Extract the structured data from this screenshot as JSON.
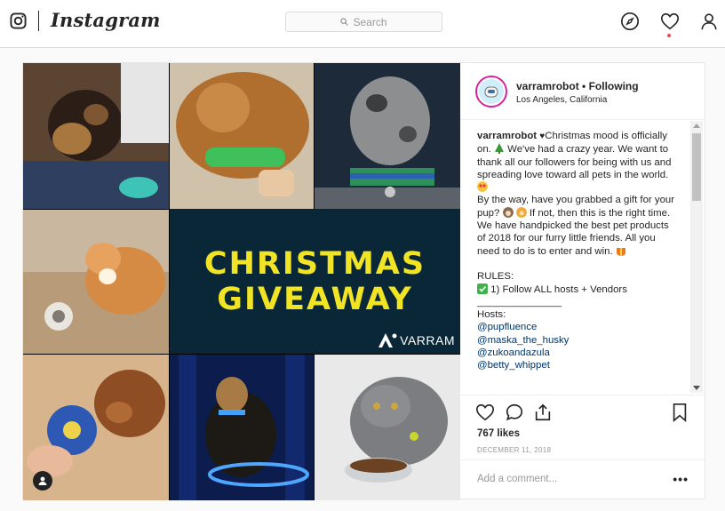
{
  "app": {
    "wordmark": "Instagram"
  },
  "search": {
    "placeholder": "Search"
  },
  "nav": {
    "icons": [
      "explore-icon",
      "activity-heart-icon",
      "profile-icon"
    ],
    "notification_color": "#ed4956"
  },
  "post": {
    "username": "varramrobot",
    "follow_status": "Following",
    "location": "Los Angeles, California",
    "media": {
      "headline_line1": "CHRISTMAS",
      "headline_line2": "GIVEAWAY",
      "brand": "VARRAM",
      "headline_color": "#f1e424",
      "panel_color": "#0a2737"
    },
    "caption": {
      "p1": "Christmas mood is officially on.",
      "p1b": " We've had a crazy year. We want to thank all our followers for being with us and spreading love toward all pets in the world.",
      "p2": "By the way, have you grabbed a gift for your pup?",
      "p2b": " If not, then this is the right time. We have handpicked the best pet products of 2018 for our furry little friends. All you need to do is to enter and win.",
      "rules_label": "RULES:",
      "rule1": " 1) Follow ALL hosts + Vendors",
      "divider": "_______________",
      "hosts_label": "Hosts:",
      "hosts": [
        "@pupfluence",
        "@maska_the_husky",
        "@zukoandazula",
        "@betty_whippet"
      ]
    },
    "likes": "767 likes",
    "date": "DECEMBER 11, 2018",
    "comment_placeholder": "Add a comment...",
    "more": "•••"
  }
}
